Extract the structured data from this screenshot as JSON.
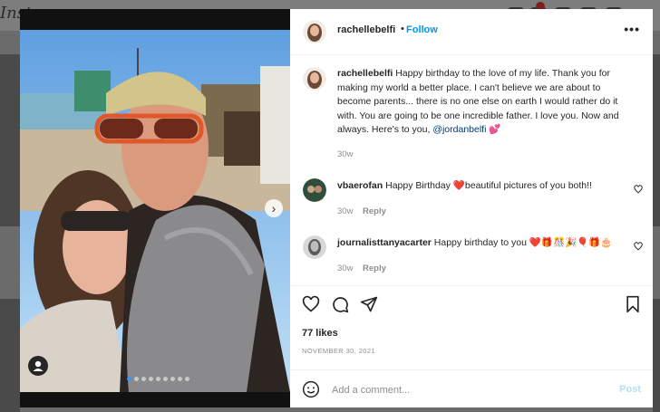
{
  "background": {
    "logo_text": "Inst"
  },
  "post": {
    "author": "rachellebelfi",
    "follow_label": "Follow",
    "more_label": "•••",
    "caption_author": "rachellebelfi",
    "caption_text": "Happy birthday to the love of my life. Thank you for making my world a better place. I can't believe we are about to become parents... there is no one else on earth I would rather do it with. You are going to be one incredible father. I love you. Now and always. Here's to you, ",
    "caption_mention": "@jordanbelfi",
    "caption_emoji": "💕",
    "caption_time": "30w",
    "next_label": "›"
  },
  "comments": [
    {
      "user": "vbaerofan",
      "text": "Happy Birthday ❤️beautiful pictures of you both!!",
      "time": "30w",
      "reply": "Reply"
    },
    {
      "user": "journalisttanyacarter",
      "text": "Happy birthday to you ❤️🎁🎊🎉🎈🎁🎂",
      "time": "30w",
      "reply": "Reply"
    }
  ],
  "likes": "77 likes",
  "date": "NOVEMBER 30, 2021",
  "add_comment": {
    "placeholder": "Add a comment...",
    "post_label": "Post"
  },
  "colors": {
    "link": "#0095f6",
    "mention": "#00376b",
    "muted": "#8e8e8e"
  }
}
